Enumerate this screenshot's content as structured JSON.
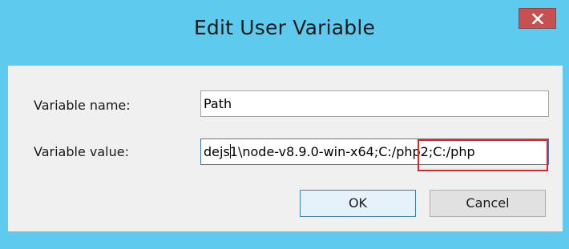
{
  "window": {
    "title": "Edit User Variable"
  },
  "form": {
    "name_label": "Variable name:",
    "name_value": "Path",
    "value_label": "Variable value:",
    "value_before_caret": "dejs",
    "value_after_caret": "1\\node-v8.9.0-win-x64;C:/php2;C:/php"
  },
  "buttons": {
    "ok_label": "OK",
    "cancel_label": "Cancel"
  },
  "colors": {
    "titlebar": "#5ecbee",
    "close_button": "#c75050",
    "highlight": "#e0252a"
  },
  "icons": {
    "close": "close-x-icon"
  }
}
